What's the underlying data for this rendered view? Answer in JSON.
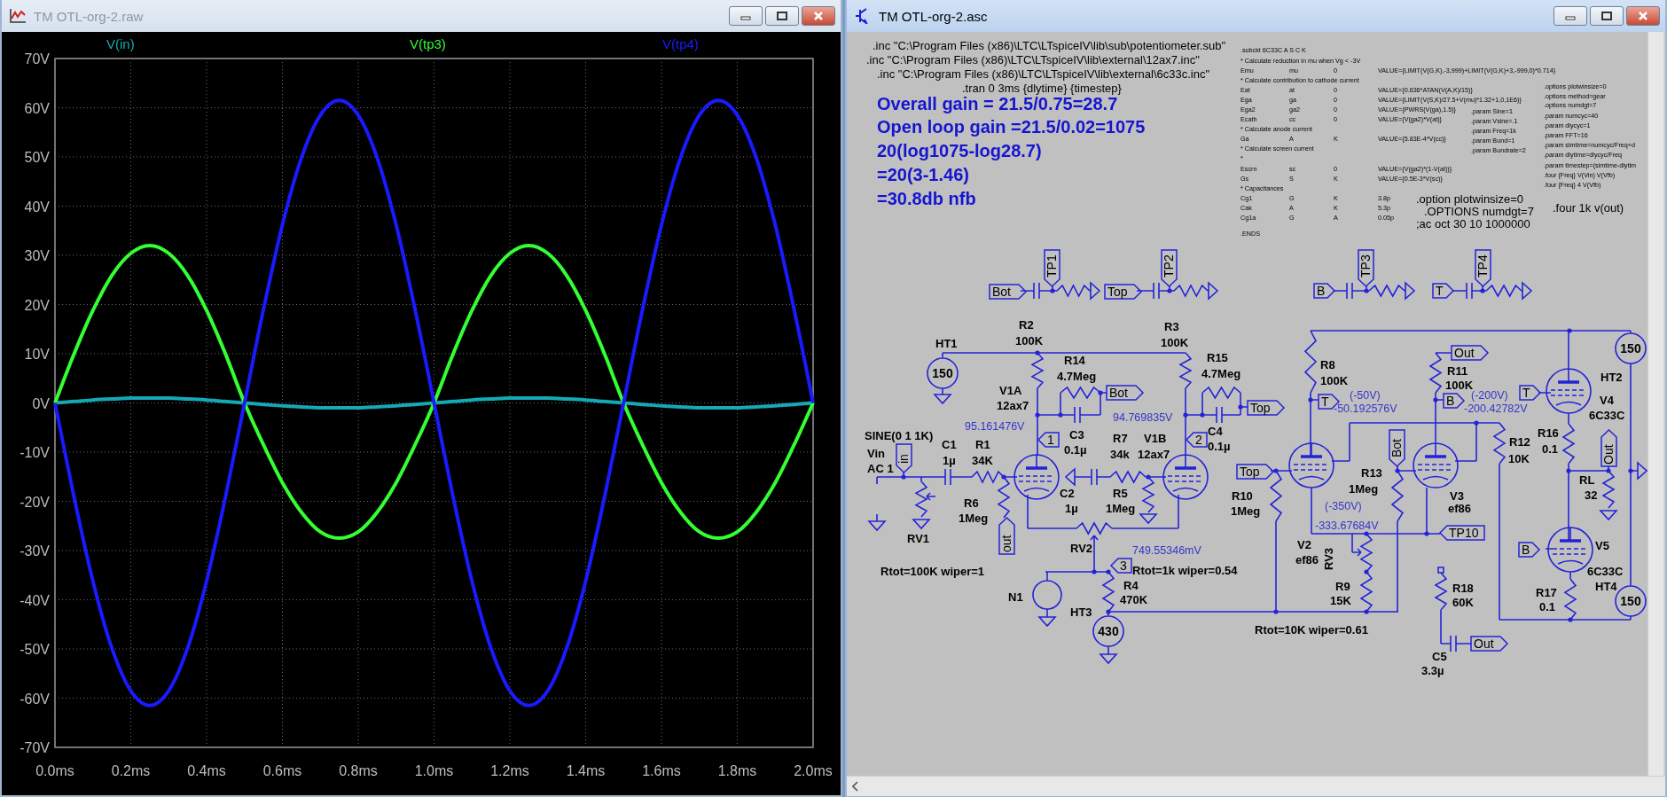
{
  "plot_window": {
    "title": "TM OTL-org-2.raw",
    "active": false,
    "chart_data": {
      "type": "line",
      "grid": true,
      "x": [
        0,
        0.05,
        0.1,
        0.15,
        0.2,
        0.25,
        0.3,
        0.35,
        0.4,
        0.45,
        0.5,
        0.55,
        0.6,
        0.65,
        0.7,
        0.75,
        0.8,
        0.85,
        0.9,
        0.95,
        1,
        1.05,
        1.1,
        1.15,
        1.2,
        1.25,
        1.3,
        1.35,
        1.4,
        1.45,
        1.5,
        1.55,
        1.6,
        1.65,
        1.7,
        1.75,
        1.8,
        1.85,
        1.9,
        1.95,
        2
      ],
      "series": [
        {
          "name": "V(in)",
          "color": "#14a9b4",
          "values": [
            0,
            0.3,
            0.6,
            0.8,
            1,
            1,
            1,
            0.8,
            0.6,
            0.3,
            0,
            -0.3,
            -0.6,
            -0.8,
            -1,
            -1,
            -1,
            -0.8,
            -0.6,
            -0.3,
            0,
            0.3,
            0.6,
            0.8,
            1,
            1,
            1,
            0.8,
            0.6,
            0.3,
            0,
            -0.3,
            -0.6,
            -0.8,
            -1,
            -1,
            -1,
            -0.8,
            -0.6,
            -0.3,
            0
          ]
        },
        {
          "name": "V(tp3)",
          "color": "#33ff33",
          "values": [
            0,
            9.9,
            18.8,
            25.9,
            30.4,
            32,
            30.4,
            25.9,
            18.8,
            9.9,
            0,
            -8.5,
            -16.2,
            -22.2,
            -26.2,
            -27.5,
            -26.2,
            -22.2,
            -16.2,
            -8.5,
            0,
            9.9,
            18.8,
            25.9,
            30.4,
            32,
            30.4,
            25.9,
            18.8,
            9.9,
            0,
            -8.5,
            -16.2,
            -22.2,
            -26.2,
            -27.5,
            -26.2,
            -22.2,
            -16.2,
            -8.5,
            0
          ]
        },
        {
          "name": "V(tp4)",
          "color": "#1a1aff",
          "values": [
            0,
            -19,
            -36.2,
            -49.8,
            -58.5,
            -61.5,
            -58.5,
            -49.8,
            -36.2,
            -19,
            0,
            19,
            36.2,
            49.8,
            58.5,
            61.5,
            58.5,
            49.8,
            36.2,
            19,
            0,
            -19,
            -36.2,
            -49.8,
            -58.5,
            -61.5,
            -58.5,
            -49.8,
            -36.2,
            -19,
            0,
            19,
            36.2,
            49.8,
            58.5,
            61.5,
            58.5,
            49.8,
            36.2,
            19,
            0
          ]
        }
      ],
      "xlim": [
        0,
        2
      ],
      "ylim": [
        -70,
        70
      ],
      "xticks": [
        {
          "value": 0,
          "label": "0.0ms"
        },
        {
          "value": 0.2,
          "label": "0.2ms"
        },
        {
          "value": 0.4,
          "label": "0.4ms"
        },
        {
          "value": 0.6,
          "label": "0.6ms"
        },
        {
          "value": 0.8,
          "label": "0.8ms"
        },
        {
          "value": 1,
          "label": "1.0ms"
        },
        {
          "value": 1.2,
          "label": "1.2ms"
        },
        {
          "value": 1.4,
          "label": "1.4ms"
        },
        {
          "value": 1.6,
          "label": "1.6ms"
        },
        {
          "value": 1.8,
          "label": "1.8ms"
        },
        {
          "value": 2,
          "label": "2.0ms"
        }
      ],
      "yticks": [
        {
          "value": 70,
          "label": "70V"
        },
        {
          "value": 60,
          "label": "60V"
        },
        {
          "value": 50,
          "label": "50V"
        },
        {
          "value": 40,
          "label": "40V"
        },
        {
          "value": 30,
          "label": "30V"
        },
        {
          "value": 20,
          "label": "20V"
        },
        {
          "value": 10,
          "label": "10V"
        },
        {
          "value": 0,
          "label": "0V"
        },
        {
          "value": -10,
          "label": "-10V"
        },
        {
          "value": -20,
          "label": "-20V"
        },
        {
          "value": -30,
          "label": "-30V"
        },
        {
          "value": -40,
          "label": "-40V"
        },
        {
          "value": -50,
          "label": "-50V"
        },
        {
          "value": -60,
          "label": "-60V"
        },
        {
          "value": -70,
          "label": "-70V"
        }
      ]
    }
  },
  "schematic_window": {
    "title": "TM OTL-org-2.asc",
    "active": true,
    "directives": [
      {
        "kind": "include",
        "text": ".inc \"C:\\Program Files (x86)\\LTC\\LTspiceIV\\lib\\sub\\potentiometer.sub\""
      },
      {
        "kind": "include",
        "text": ".inc \"C:\\Program Files (x86)\\LTC\\LTspiceIV\\lib\\external\\12ax7.inc\""
      },
      {
        "kind": "include",
        "text": ".inc \"C:\\Program Files (x86)\\LTC\\LTspiceIV\\lib\\external\\6c33c.inc\""
      },
      {
        "kind": "command",
        "text": ".tran 0 3ms {dlytime} {timestep}"
      },
      {
        "kind": "gain_note",
        "text": "Overall gain = 21.5/0.75=28.7"
      },
      {
        "kind": "gain_note",
        "text": "Open loop gain =21.5/0.02=1075"
      },
      {
        "kind": "gain_note",
        "text": "20(log1075-log28.7)"
      },
      {
        "kind": "gain_note",
        "text": "=20(3-1.46)"
      },
      {
        "kind": "gain_note",
        "text": "=30.8db nfb"
      },
      {
        "kind": "param",
        "text": ".param Sine=1"
      },
      {
        "kind": "param",
        "text": ".param Vsine=.1"
      },
      {
        "kind": "param",
        "text": ".param Freq=1k"
      },
      {
        "kind": "param",
        "text": ".param Bund=1"
      },
      {
        "kind": "param",
        "text": ".param Bundrate=2"
      },
      {
        "kind": "param",
        "text": ".options plotwinsize=0"
      },
      {
        "kind": "param",
        "text": ".options method=gear"
      },
      {
        "kind": "param",
        "text": ".options numdgt=7"
      },
      {
        "kind": "param",
        "text": ".param numcyc=40"
      },
      {
        "kind": "param",
        "text": ".param dlycyc=1"
      },
      {
        "kind": "param",
        "text": ".param FFT=16"
      },
      {
        "kind": "param",
        "text": ".param simtime=numcyc/Freq+d"
      },
      {
        "kind": "param",
        "text": ".param dlytime=dlycyc/Freq"
      },
      {
        "kind": "param",
        "text": ".param timestep=(simtime-dlytim"
      },
      {
        "kind": "param",
        "text": ".four {Freq} V(Vin) V(Vfb)"
      },
      {
        "kind": "param",
        "text": ".four {Freq} 4 V(Vfb)"
      },
      {
        "kind": "option",
        "text": ".option plotwinsize=0"
      },
      {
        "kind": "option",
        "text": ".OPTIONS numdgt=7"
      },
      {
        "kind": "option",
        "text": ";ac oct 30 10 1000000"
      },
      {
        "kind": "option",
        "text": ".four 1k v(out)"
      }
    ],
    "netlist_rows": [
      {
        "cells": [
          ".subckt 6C33C A S C K"
        ]
      },
      {
        "cells": [
          "* Calculate reduction in mu when Vg < -3V"
        ]
      },
      {
        "cells": [
          "Emu",
          "mu",
          "0",
          "VALUE={LIMIT(V(G,K),-3,999)+LIMIT(V(G,K)+3,-999,0)*0.714}"
        ]
      },
      {
        "cells": [
          "* Calculate contribution to cathode current"
        ]
      },
      {
        "cells": [
          "Eat",
          "at",
          "0",
          "VALUE={0.636*ATAN(V(A,K)/15)}"
        ]
      },
      {
        "cells": [
          "Ega",
          "ga",
          "0",
          "VALUE={LIMIT(V(S,K)/27.5+V(mu)*1.32+1,0,1E6)}"
        ]
      },
      {
        "cells": [
          "Ega2",
          "ga2",
          "0",
          "VALUE={PWRS(V(ga),1.5)}"
        ]
      },
      {
        "cells": [
          "Ecath",
          "cc",
          "0",
          "VALUE={V(ga2)*V(at)}"
        ]
      },
      {
        "cells": [
          "* Calculate anode current"
        ]
      },
      {
        "cells": [
          "Ga",
          "A",
          "K",
          "VALUE={5.83E-4*V(cc)}"
        ]
      },
      {
        "cells": [
          "* Calculate screen current"
        ]
      },
      {
        "cells": [
          "*"
        ]
      },
      {
        "cells": [
          "Escrn",
          "sc",
          "0",
          "VALUE={V(ga2)*(1-V(at))}"
        ]
      },
      {
        "cells": [
          "Gs",
          "S",
          "K",
          "VALUE={0.5E-3*V(sc)}"
        ]
      },
      {
        "cells": [
          "* Capacitances"
        ]
      },
      {
        "cells": [
          "Cg1",
          "G",
          "K",
          "3.8p"
        ]
      },
      {
        "cells": [
          "Cak",
          "A",
          "K",
          "5.3p"
        ]
      },
      {
        "cells": [
          "Cg1a",
          "G",
          "A",
          "0.05p"
        ]
      },
      {
        "cells": [
          ".ENDS"
        ]
      }
    ],
    "labels": [
      {
        "kind": "flag",
        "text": "Bot"
      },
      {
        "kind": "flag_down",
        "text": "TP1"
      },
      {
        "kind": "flag",
        "text": "Top"
      },
      {
        "kind": "flag_down",
        "text": "TP2"
      },
      {
        "kind": "flag",
        "text": "B"
      },
      {
        "kind": "flag_down",
        "text": "TP3"
      },
      {
        "kind": "flag",
        "text": "T"
      },
      {
        "kind": "flag_down",
        "text": "TP4"
      },
      {
        "kind": "part",
        "text": "HT1"
      },
      {
        "kind": "source",
        "text": "150"
      },
      {
        "kind": "part",
        "text": "R2"
      },
      {
        "kind": "part",
        "text": "100K"
      },
      {
        "kind": "part",
        "text": "R3"
      },
      {
        "kind": "part",
        "text": "100K"
      },
      {
        "kind": "part",
        "text": "R14"
      },
      {
        "kind": "part",
        "text": "4.7Meg"
      },
      {
        "kind": "part",
        "text": "R15"
      },
      {
        "kind": "part",
        "text": "4.7Meg"
      },
      {
        "kind": "part",
        "text": "V1A"
      },
      {
        "kind": "part",
        "text": "12ax7"
      },
      {
        "kind": "flag",
        "text": "Bot"
      },
      {
        "kind": "flag",
        "text": "Top"
      },
      {
        "kind": "voltage",
        "text": "95.161476V"
      },
      {
        "kind": "voltage",
        "text": "94.769835V"
      },
      {
        "kind": "flag_left",
        "text": "1"
      },
      {
        "kind": "flag_left",
        "text": "2"
      },
      {
        "kind": "part",
        "text": "C3"
      },
      {
        "kind": "part",
        "text": "0.1µ"
      },
      {
        "kind": "part",
        "text": "C4"
      },
      {
        "kind": "part",
        "text": "0.1µ"
      },
      {
        "kind": "part",
        "text": "SINE(0 1 1K)"
      },
      {
        "kind": "part",
        "text": "Vin"
      },
      {
        "kind": "part",
        "text": "AC 1"
      },
      {
        "kind": "flag_down",
        "text": "in"
      },
      {
        "kind": "part",
        "text": "C1"
      },
      {
        "kind": "part",
        "text": "1µ"
      },
      {
        "kind": "part",
        "text": "R1"
      },
      {
        "kind": "part",
        "text": "34K"
      },
      {
        "kind": "part",
        "text": "R7"
      },
      {
        "kind": "part",
        "text": "34k"
      },
      {
        "kind": "part",
        "text": "V1B"
      },
      {
        "kind": "part",
        "text": "12ax7"
      },
      {
        "kind": "flag",
        "text": "Top"
      },
      {
        "kind": "part",
        "text": "R10"
      },
      {
        "kind": "part",
        "text": "1Meg"
      },
      {
        "kind": "part",
        "text": "R6"
      },
      {
        "kind": "part",
        "text": "1Meg"
      },
      {
        "kind": "flag_up",
        "text": "out"
      },
      {
        "kind": "part",
        "text": "C2"
      },
      {
        "kind": "part",
        "text": "1µ"
      },
      {
        "kind": "part",
        "text": "R5"
      },
      {
        "kind": "part",
        "text": "1Meg"
      },
      {
        "kind": "part",
        "text": "RV1"
      },
      {
        "kind": "part",
        "text": "Rtot=100K wiper=1"
      },
      {
        "kind": "part",
        "text": "RV2"
      },
      {
        "kind": "voltage",
        "text": "749.55346mV"
      },
      {
        "kind": "flag_left",
        "text": "3"
      },
      {
        "kind": "part",
        "text": "Rtot=1k wiper=0.54"
      },
      {
        "kind": "part",
        "text": "N1"
      },
      {
        "kind": "part",
        "text": "R4"
      },
      {
        "kind": "part",
        "text": "470K"
      },
      {
        "kind": "part",
        "text": "HT3"
      },
      {
        "kind": "source",
        "text": "430"
      },
      {
        "kind": "part",
        "text": "R8"
      },
      {
        "kind": "part",
        "text": "100K"
      },
      {
        "kind": "flag",
        "text": "T"
      },
      {
        "kind": "voltage",
        "text": "(-50V)"
      },
      {
        "kind": "voltage",
        "text": "-50.192576V"
      },
      {
        "kind": "flag",
        "text": "Out"
      },
      {
        "kind": "part",
        "text": "R11"
      },
      {
        "kind": "part",
        "text": "100K"
      },
      {
        "kind": "flag",
        "text": "B"
      },
      {
        "kind": "voltage",
        "text": "(-200V)"
      },
      {
        "kind": "flag",
        "text": "T"
      },
      {
        "kind": "voltage",
        "text": "-200.42782V"
      },
      {
        "kind": "source",
        "text": "150"
      },
      {
        "kind": "part",
        "text": "HT2"
      },
      {
        "kind": "part",
        "text": "V4"
      },
      {
        "kind": "part",
        "text": "6C33C"
      },
      {
        "kind": "part",
        "text": "R16"
      },
      {
        "kind": "part",
        "text": "0.1"
      },
      {
        "kind": "flag_up",
        "text": "Out"
      },
      {
        "kind": "part",
        "text": "R12"
      },
      {
        "kind": "part",
        "text": "10K"
      },
      {
        "kind": "part",
        "text": "RL"
      },
      {
        "kind": "part",
        "text": "32"
      },
      {
        "kind": "flag_down",
        "text": "Bot"
      },
      {
        "kind": "part",
        "text": "R13"
      },
      {
        "kind": "part",
        "text": "1Meg"
      },
      {
        "kind": "part",
        "text": "V3"
      },
      {
        "kind": "voltage",
        "text": "(-350V)"
      },
      {
        "kind": "part",
        "text": "ef86"
      },
      {
        "kind": "voltage",
        "text": "-333.67684V"
      },
      {
        "kind": "flag_left",
        "text": "TP10"
      },
      {
        "kind": "part",
        "text": "V2"
      },
      {
        "kind": "part",
        "text": "ef86"
      },
      {
        "kind": "part_vertical",
        "text": "RV3"
      },
      {
        "kind": "part",
        "text": "R9"
      },
      {
        "kind": "part",
        "text": "15K"
      },
      {
        "kind": "part",
        "text": "Rtot=10K wiper=0.61"
      },
      {
        "kind": "part",
        "text": "R18"
      },
      {
        "kind": "part",
        "text": "60K"
      },
      {
        "kind": "part",
        "text": "C5"
      },
      {
        "kind": "part",
        "text": "3.3µ"
      },
      {
        "kind": "flag",
        "text": "Out"
      },
      {
        "kind": "flag",
        "text": "B"
      },
      {
        "kind": "part",
        "text": "V5"
      },
      {
        "kind": "part",
        "text": "6C33C"
      },
      {
        "kind": "part",
        "text": "HT4"
      },
      {
        "kind": "part",
        "text": "R17"
      },
      {
        "kind": "part",
        "text": "0.1"
      },
      {
        "kind": "source",
        "text": "150"
      }
    ]
  }
}
